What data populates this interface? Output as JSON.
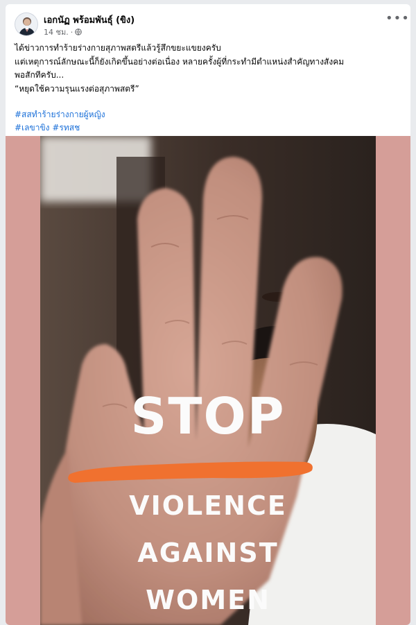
{
  "post": {
    "author": "เอกนัฏ พร้อมพันธุ์ (ขิง)",
    "time": "14 ชม.",
    "separator": "·",
    "avatar_icon": "person-avatar-icon",
    "privacy_icon": "globe-icon",
    "more_icon": "more-options-icon",
    "more_label": "•••",
    "lines": [
      "ได้ข่าวการทำร้ายร่างกายสุภาพสตรีแล้วรู้สึกขยะแขยงครับ",
      "แต่เหตุการณ์ลักษณะนี้ก็ยังเกิดขึ้นอย่างต่อเนื่อง หลายครั้งผู้ที่กระทำมีตำแหน่งสำคัญทางสังคม",
      "พอสักทีครับ...",
      "“หยุดใช้ความรุนแรงต่อสุภาพสตรี”"
    ],
    "hashtags": {
      "line1": "#สสทำร้ายร่างกายผู้หญิง",
      "line2a": "#เลขาขิง",
      "line2b": "#รทสช"
    }
  },
  "photo": {
    "line1": "STOP",
    "line2": "VIOLENCE",
    "line3": "AGAINST",
    "line4": "WOMEN",
    "underline_color": "#f0712f",
    "frame_color": "#d59e98"
  }
}
